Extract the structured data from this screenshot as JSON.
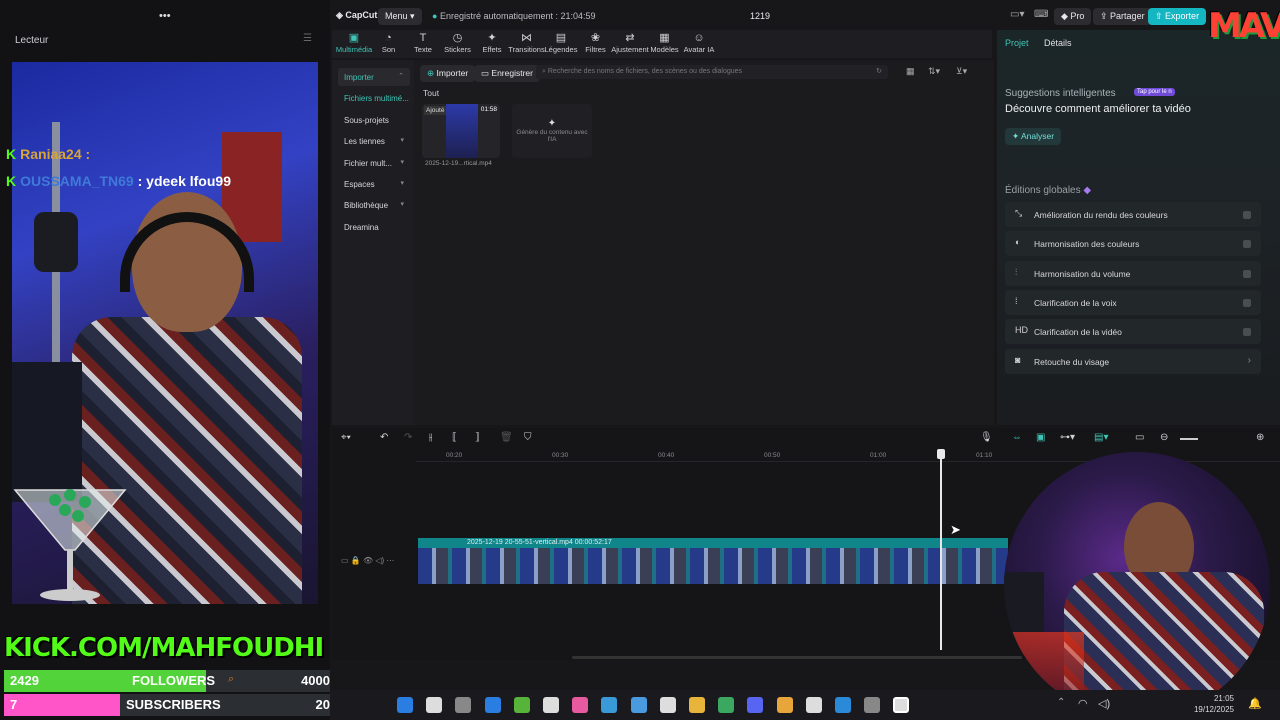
{
  "overlay": {
    "player_label": "Lecteur",
    "more_dots": "•••",
    "chat": [
      {
        "user": "Raniaa24",
        "suffix": " :",
        "message": ""
      },
      {
        "user": "OUSSAMA_TN69",
        "suffix": " :",
        "message": " ydeek lfou99"
      }
    ],
    "kick_banner": "KICK.COM/MAHFOUDHI",
    "followers": {
      "count": "2429",
      "label": "FOLLOWERS",
      "goal": "4000",
      "progress": 0.607
    },
    "subscribers": {
      "count": "7",
      "label": "SUBSCRIBERS",
      "goal": "20",
      "progress": 0.35
    },
    "logo": "MAV"
  },
  "capcut": {
    "app_name": "CapCut",
    "menu_label": "Menu",
    "autosave": "Enregistré automatiquement : 21:04:59",
    "project_name": "1219",
    "pro_label": "Pro",
    "share_label": "Partager",
    "export_label": "Exporter",
    "tools": [
      {
        "icon": "▣",
        "label": "Multimédia",
        "active": true
      },
      {
        "icon": "◔",
        "label": "Son"
      },
      {
        "icon": "T",
        "label": "Texte"
      },
      {
        "icon": "◷",
        "label": "Stickers"
      },
      {
        "icon": "✦",
        "label": "Effets"
      },
      {
        "icon": "⋈",
        "label": "Transitions"
      },
      {
        "icon": "▤",
        "label": "Légendes"
      },
      {
        "icon": "❀",
        "label": "Filtres"
      },
      {
        "icon": "⇄",
        "label": "Ajustement"
      },
      {
        "icon": "▦",
        "label": "Modèles"
      },
      {
        "icon": "☺",
        "label": "Avatar IA"
      }
    ],
    "nav": [
      {
        "label": "Importer",
        "arrow": "⌃",
        "active": true
      },
      {
        "label": "Fichiers multimé...",
        "arrow": "",
        "active": false,
        "accent": true
      },
      {
        "label": "Sous-projets",
        "arrow": ""
      },
      {
        "label": "Les tiennes",
        "arrow": "▾"
      },
      {
        "label": "Fichier mult...",
        "arrow": "▾"
      },
      {
        "label": "Espaces",
        "arrow": "▾"
      },
      {
        "label": "Bibliothèque",
        "arrow": "▾"
      },
      {
        "label": "Dreamina",
        "arrow": ""
      }
    ],
    "import_button": "Importer",
    "record_button": "Enregistrer",
    "search_placeholder": "Recherche des noms de fichiers, des scènes ou des dialogues",
    "filter_all": "Tout",
    "media_item": {
      "badge": "Ajouté",
      "duration": "01:58",
      "name": "2025-12-19...rtical.mp4"
    },
    "ai_card": "Génère du contenu avec l'IA",
    "right_tabs": [
      "Projet",
      "Détails"
    ],
    "smart_title": "Suggestions intelligentes",
    "smart_badge": "Tap pour le n",
    "smart_heading": "Découvre comment améliorer ta vidéo",
    "analyze_button": "Analyser",
    "global_edits_title": "Éditions globales",
    "global_edits": [
      {
        "icon": "⤡",
        "label": "Amélioration du rendu des couleurs",
        "control": "toggle"
      },
      {
        "icon": "◐",
        "label": "Harmonisation des couleurs",
        "control": "toggle"
      },
      {
        "icon": "⫶",
        "label": "Harmonisation du volume",
        "control": "toggle"
      },
      {
        "icon": "⁞",
        "label": "Clarification de la voix",
        "control": "toggle"
      },
      {
        "icon": "HD",
        "label": "Clarification de la vidéo",
        "control": "toggle"
      },
      {
        "icon": "◙",
        "label": "Retouche du visage",
        "control": "arrow"
      }
    ],
    "ruler_ticks": [
      "00:20",
      "00:30",
      "00:40",
      "00:50",
      "01:00",
      "01:10"
    ],
    "clip_label": "2025-12-19 20-55-51-vertical.mp4   00:00:52:17"
  },
  "taskbar": {
    "time": "21:05",
    "date": "19/12/2025"
  }
}
